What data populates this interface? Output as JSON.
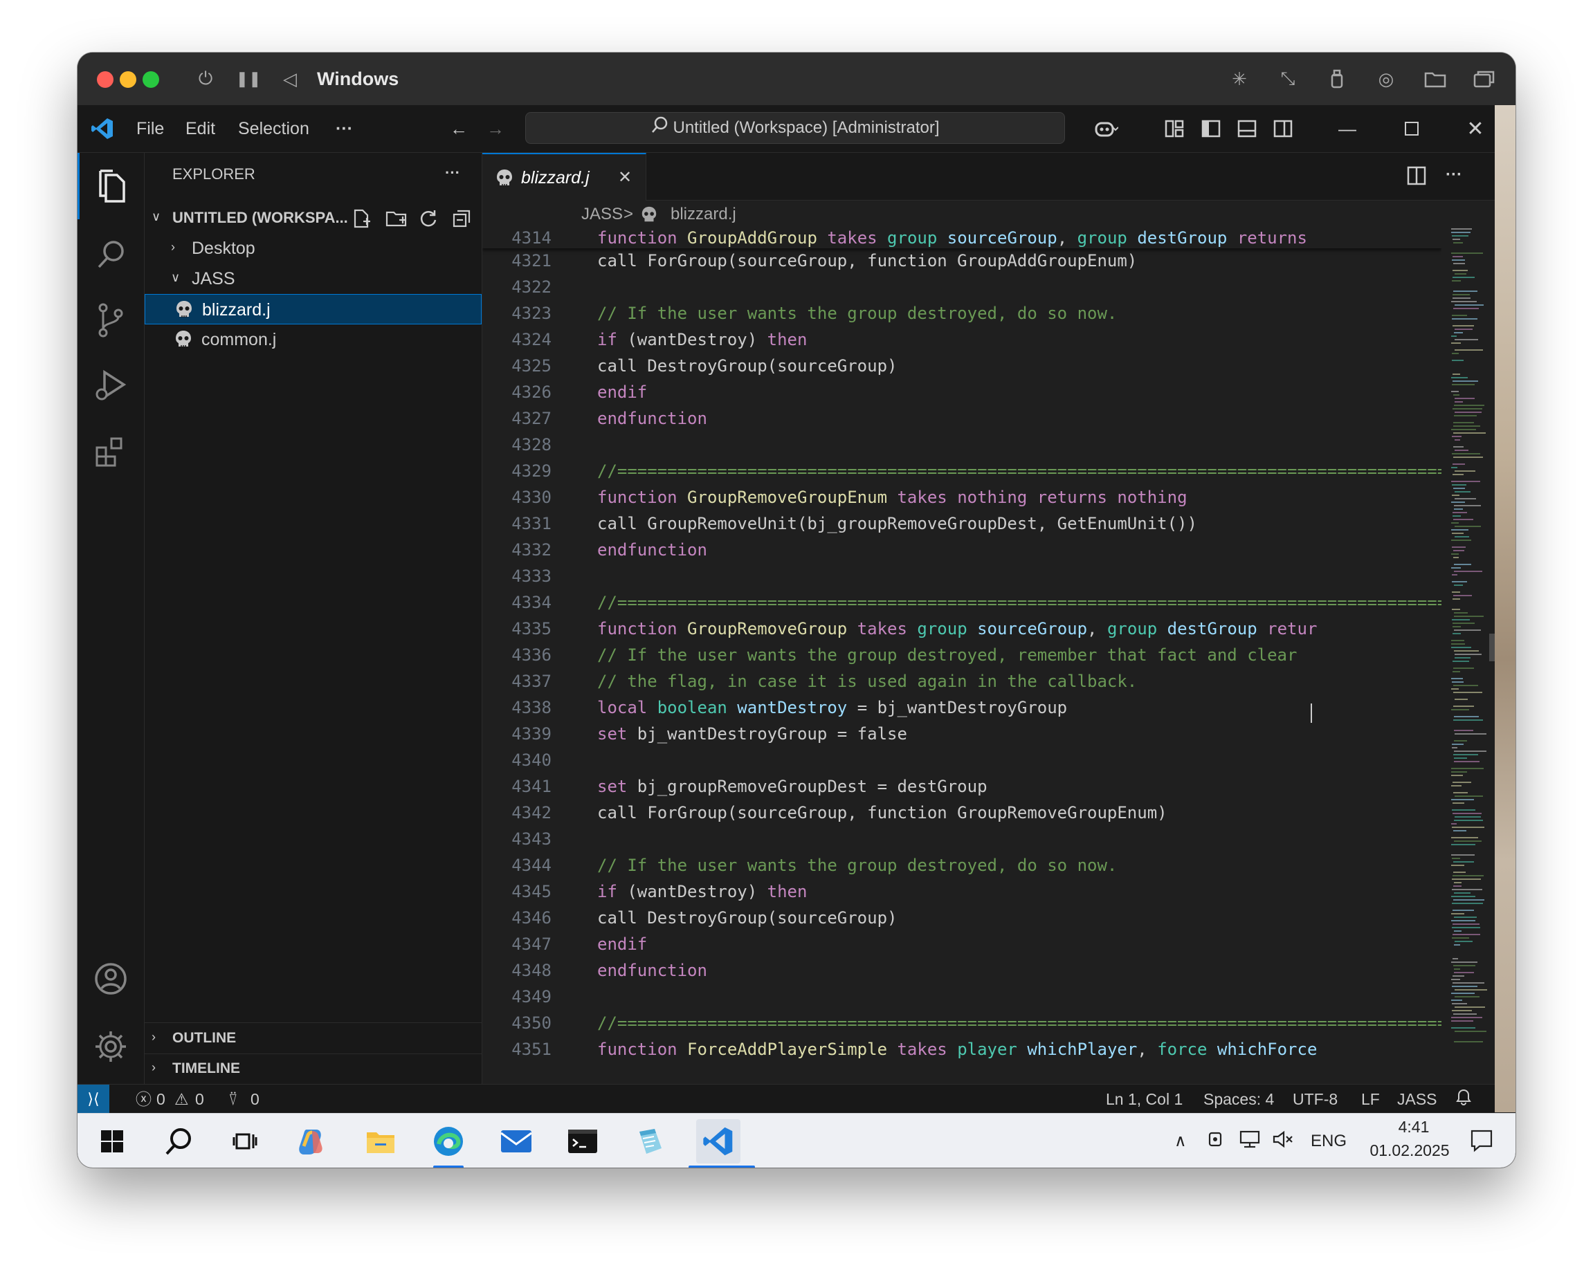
{
  "mac_titlebar": {
    "title": "Windows"
  },
  "vscode": {
    "menu": [
      "File",
      "Edit",
      "Selection",
      "···"
    ],
    "command_center": "Untitled (Workspace) [Administrator]",
    "explorer": {
      "header": "EXPLORER",
      "more": "···",
      "workspace": "UNTITLED (WORKSPA...",
      "folders": [
        {
          "label": "Desktop",
          "expanded": false
        },
        {
          "label": "JASS",
          "expanded": true
        }
      ],
      "files": [
        "blizzard.j",
        "common.j"
      ],
      "selected_file": "blizzard.j",
      "outline": "OUTLINE",
      "timeline": "TIMELINE"
    },
    "tab": {
      "label": "blizzard.j",
      "close": "✕"
    },
    "editor_more": "···",
    "breadcrumb": {
      "folder": "JASS",
      "sep": ">",
      "file": "blizzard.j"
    },
    "sticky": {
      "line": "4314",
      "tokens": [
        [
          "kw",
          "function "
        ],
        [
          "fn",
          "GroupAddGroup "
        ],
        [
          "kw",
          "takes "
        ],
        [
          "ty",
          "group "
        ],
        [
          "var",
          "sourceGroup"
        ],
        [
          "pl",
          ", "
        ],
        [
          "ty",
          "group "
        ],
        [
          "var",
          "destGroup "
        ],
        [
          "kw",
          "returns"
        ]
      ]
    },
    "code": [
      {
        "n": "4321",
        "t": [
          [
            "pl",
            "call ForGroup(sourceGroup, function GroupAddGroupEnum)"
          ]
        ]
      },
      {
        "n": "4322",
        "t": []
      },
      {
        "n": "4323",
        "t": [
          [
            "cm",
            "// If the user wants the group destroyed, do so now."
          ]
        ]
      },
      {
        "n": "4324",
        "t": [
          [
            "kw",
            "if "
          ],
          [
            "pl",
            "(wantDestroy) "
          ],
          [
            "kw",
            "then"
          ]
        ]
      },
      {
        "n": "4325",
        "t": [
          [
            "pl",
            "call DestroyGroup(sourceGroup)"
          ]
        ]
      },
      {
        "n": "4326",
        "t": [
          [
            "kw",
            "endif"
          ]
        ]
      },
      {
        "n": "4327",
        "t": [
          [
            "kw",
            "endfunction"
          ]
        ]
      },
      {
        "n": "4328",
        "t": []
      },
      {
        "n": "4329",
        "t": [
          [
            "cm",
            "//==================================================================================="
          ]
        ]
      },
      {
        "n": "4330",
        "t": [
          [
            "kw",
            "function "
          ],
          [
            "fn",
            "GroupRemoveGroupEnum "
          ],
          [
            "kw",
            "takes "
          ],
          [
            "kw",
            "nothing "
          ],
          [
            "kw",
            "returns "
          ],
          [
            "kw",
            "nothing"
          ]
        ]
      },
      {
        "n": "4331",
        "t": [
          [
            "pl",
            "call GroupRemoveUnit(bj_groupRemoveGroupDest, GetEnumUnit())"
          ]
        ]
      },
      {
        "n": "4332",
        "t": [
          [
            "kw",
            "endfunction"
          ]
        ]
      },
      {
        "n": "4333",
        "t": []
      },
      {
        "n": "4334",
        "t": [
          [
            "cm",
            "//==================================================================================="
          ]
        ]
      },
      {
        "n": "4335",
        "t": [
          [
            "kw",
            "function "
          ],
          [
            "fn",
            "GroupRemoveGroup "
          ],
          [
            "kw",
            "takes "
          ],
          [
            "ty",
            "group "
          ],
          [
            "var",
            "sourceGroup"
          ],
          [
            "pl",
            ", "
          ],
          [
            "ty",
            "group "
          ],
          [
            "var",
            "destGroup "
          ],
          [
            "kw",
            "retur"
          ]
        ]
      },
      {
        "n": "4336",
        "t": [
          [
            "cm",
            "// If the user wants the group destroyed, remember that fact and clear"
          ]
        ]
      },
      {
        "n": "4337",
        "t": [
          [
            "cm",
            "// the flag, in case it is used again in the callback."
          ]
        ]
      },
      {
        "n": "4338",
        "t": [
          [
            "kw",
            "local "
          ],
          [
            "ty",
            "boolean "
          ],
          [
            "var",
            "wantDestroy "
          ],
          [
            "pl",
            "= bj_wantDestroyGroup"
          ]
        ]
      },
      {
        "n": "4339",
        "t": [
          [
            "kw",
            "set "
          ],
          [
            "pl",
            "bj_wantDestroyGroup = false"
          ]
        ]
      },
      {
        "n": "4340",
        "t": []
      },
      {
        "n": "4341",
        "t": [
          [
            "kw",
            "set "
          ],
          [
            "pl",
            "bj_groupRemoveGroupDest = destGroup"
          ]
        ]
      },
      {
        "n": "4342",
        "t": [
          [
            "pl",
            "call ForGroup(sourceGroup, function GroupRemoveGroupEnum)"
          ]
        ]
      },
      {
        "n": "4343",
        "t": []
      },
      {
        "n": "4344",
        "t": [
          [
            "cm",
            "// If the user wants the group destroyed, do so now."
          ]
        ]
      },
      {
        "n": "4345",
        "t": [
          [
            "kw",
            "if "
          ],
          [
            "pl",
            "(wantDestroy) "
          ],
          [
            "kw",
            "then"
          ]
        ]
      },
      {
        "n": "4346",
        "t": [
          [
            "pl",
            "call DestroyGroup(sourceGroup)"
          ]
        ]
      },
      {
        "n": "4347",
        "t": [
          [
            "kw",
            "endif"
          ]
        ]
      },
      {
        "n": "4348",
        "t": [
          [
            "kw",
            "endfunction"
          ]
        ]
      },
      {
        "n": "4349",
        "t": []
      },
      {
        "n": "4350",
        "t": [
          [
            "cm",
            "//==================================================================================="
          ]
        ]
      },
      {
        "n": "4351",
        "t": [
          [
            "kw",
            "function "
          ],
          [
            "fn",
            "ForceAddPlayerSimple "
          ],
          [
            "kw",
            "takes "
          ],
          [
            "ty",
            "player "
          ],
          [
            "var",
            "whichPlayer"
          ],
          [
            "pl",
            ", "
          ],
          [
            "ty",
            "force "
          ],
          [
            "var",
            "whichForce"
          ]
        ]
      }
    ],
    "status": {
      "errors": "0",
      "warnings": "0",
      "ports": "0",
      "cursor": "Ln 1, Col 1",
      "spaces": "Spaces: 4",
      "encoding": "UTF-8",
      "eol": "LF",
      "language": "JASS"
    }
  },
  "taskbar": {
    "apps": [
      "windows-start-icon",
      "search-icon",
      "task-view-icon",
      "copilot-icon",
      "file-explorer-icon",
      "edge-icon",
      "mail-icon",
      "terminal-icon",
      "notepad-icon",
      "vscode-icon"
    ],
    "lang": "ENG",
    "time": "4:41",
    "date": "01.02.2025"
  },
  "colors": {
    "keyword": "#c586c0",
    "function": "#dcdcaa",
    "type": "#4ec9b0",
    "variable": "#9cdcfe",
    "comment": "#6a9955",
    "plain": "#cccccc",
    "accent": "#0078d4",
    "remote": "#0e639c"
  }
}
